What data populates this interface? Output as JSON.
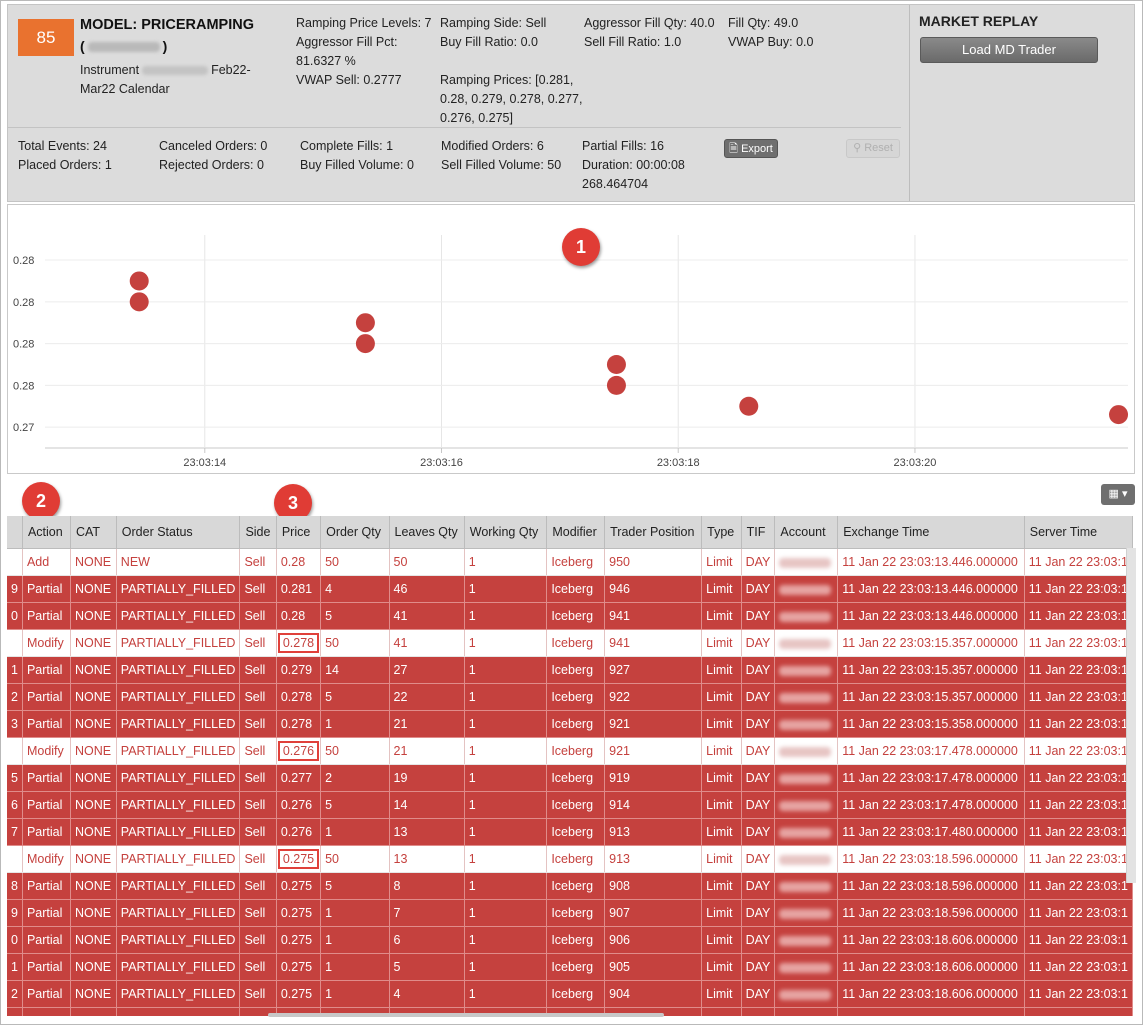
{
  "header": {
    "score": "85",
    "model_title": "MODEL: PRICERAMPING",
    "model_sub_open": "(",
    "model_sub_close": ")",
    "instrument_prefix": "Instrument",
    "instrument_suffix": "Feb22-Mar22 Calendar",
    "ramping_price_levels": "Ramping Price Levels: 7",
    "aggressor_fill_pct": "Aggressor Fill Pct: 81.6327 %",
    "vwap_sell": "VWAP Sell: 0.2777",
    "ramping_side": "Ramping Side: Sell",
    "buy_fill_ratio": "Buy Fill Ratio: 0.0",
    "ramping_prices": "Ramping Prices: [0.281, 0.28, 0.279, 0.278, 0.277, 0.276, 0.275]",
    "aggressor_fill_qty": "Aggressor Fill Qty: 40.0",
    "sell_fill_ratio": "Sell Fill Ratio: 1.0",
    "fill_qty": "Fill Qty: 49.0",
    "vwap_buy": "VWAP Buy: 0.0",
    "total_events": "Total Events: 24",
    "placed_orders": "Placed Orders: 1",
    "canceled_orders": "Canceled Orders: 0",
    "rejected_orders": "Rejected Orders: 0",
    "complete_fills": "Complete Fills: 1",
    "buy_filled_volume": "Buy Filled Volume: 0",
    "modified_orders": "Modified Orders: 6",
    "sell_filled_volume": "Sell Filled Volume: 50",
    "partial_fills": "Partial Fills: 16",
    "duration": "Duration: 00:00:08 268.464704",
    "export_label": "Export",
    "reset_label": "Reset",
    "market_replay_title": "MARKET REPLAY",
    "load_md_label": "Load MD Trader"
  },
  "callouts": [
    "1",
    "2",
    "3"
  ],
  "chart_data": {
    "type": "scatter",
    "title": "",
    "xlabel": "",
    "ylabel": "",
    "x_tick_labels": [
      "23:03:14",
      "23:03:16",
      "23:03:18",
      "23:03:20"
    ],
    "x_tick_seconds": [
      14,
      16,
      18,
      20
    ],
    "y_tick_labels": [
      "0.28",
      "0.28",
      "0.28",
      "0.28",
      "0.27"
    ],
    "y_tick_values": [
      0.28,
      0.279,
      0.278,
      0.277,
      0.276
    ],
    "xlim_seconds": [
      12.65,
      21.8
    ],
    "ylim": [
      0.2755,
      0.2806
    ],
    "grid": true,
    "point_color": "#c5413e",
    "points": [
      {
        "t": 13.446,
        "price": 0.2795
      },
      {
        "t": 13.446,
        "price": 0.279
      },
      {
        "t": 15.357,
        "price": 0.2785
      },
      {
        "t": 15.357,
        "price": 0.278
      },
      {
        "t": 17.478,
        "price": 0.2775
      },
      {
        "t": 17.478,
        "price": 0.277
      },
      {
        "t": 18.596,
        "price": 0.2765
      },
      {
        "t": 21.72,
        "price": 0.2763
      }
    ]
  },
  "table": {
    "grid_button_label": "▦ ▾",
    "columns": [
      "",
      "Action",
      "CAT",
      "Order Status",
      "Side",
      "Price",
      "Order Qty",
      "Leaves Qty",
      "Working Qty",
      "Modifier",
      "Trader Position",
      "Type",
      "TIF",
      "Account",
      "Exchange Time",
      "Server Time"
    ],
    "rows": [
      {
        "style": "white",
        "idx": "",
        "action": "Add",
        "cat": "NONE",
        "status": "NEW",
        "side": "Sell",
        "price": "0.28",
        "order_qty": "50",
        "leaves": "50",
        "working": "1",
        "modifier": "Iceberg",
        "position": "950",
        "type": "Limit",
        "tif": "DAY",
        "exchange_time": "11 Jan 22 23:03:13.446.000000",
        "server_time": "11 Jan 22 23:03:1",
        "highlight": false
      },
      {
        "style": "red",
        "idx": "9",
        "action": "Partial",
        "cat": "NONE",
        "status": "PARTIALLY_FILLED",
        "side": "Sell",
        "price": "0.281",
        "order_qty": "4",
        "leaves": "46",
        "working": "1",
        "modifier": "Iceberg",
        "position": "946",
        "type": "Limit",
        "tif": "DAY",
        "exchange_time": "11 Jan 22 23:03:13.446.000000",
        "server_time": "11 Jan 22 23:03:1",
        "highlight": false
      },
      {
        "style": "red",
        "idx": "0",
        "action": "Partial",
        "cat": "NONE",
        "status": "PARTIALLY_FILLED",
        "side": "Sell",
        "price": "0.28",
        "order_qty": "5",
        "leaves": "41",
        "working": "1",
        "modifier": "Iceberg",
        "position": "941",
        "type": "Limit",
        "tif": "DAY",
        "exchange_time": "11 Jan 22 23:03:13.446.000000",
        "server_time": "11 Jan 22 23:03:1",
        "highlight": false
      },
      {
        "style": "white",
        "idx": "",
        "action": "Modify",
        "cat": "NONE",
        "status": "PARTIALLY_FILLED",
        "side": "Sell",
        "price": "0.278",
        "order_qty": "50",
        "leaves": "41",
        "working": "1",
        "modifier": "Iceberg",
        "position": "941",
        "type": "Limit",
        "tif": "DAY",
        "exchange_time": "11 Jan 22 23:03:15.357.000000",
        "server_time": "11 Jan 22 23:03:1",
        "highlight": true
      },
      {
        "style": "red",
        "idx": "1",
        "action": "Partial",
        "cat": "NONE",
        "status": "PARTIALLY_FILLED",
        "side": "Sell",
        "price": "0.279",
        "order_qty": "14",
        "leaves": "27",
        "working": "1",
        "modifier": "Iceberg",
        "position": "927",
        "type": "Limit",
        "tif": "DAY",
        "exchange_time": "11 Jan 22 23:03:15.357.000000",
        "server_time": "11 Jan 22 23:03:1",
        "highlight": false
      },
      {
        "style": "red",
        "idx": "2",
        "action": "Partial",
        "cat": "NONE",
        "status": "PARTIALLY_FILLED",
        "side": "Sell",
        "price": "0.278",
        "order_qty": "5",
        "leaves": "22",
        "working": "1",
        "modifier": "Iceberg",
        "position": "922",
        "type": "Limit",
        "tif": "DAY",
        "exchange_time": "11 Jan 22 23:03:15.357.000000",
        "server_time": "11 Jan 22 23:03:1",
        "highlight": false
      },
      {
        "style": "red",
        "idx": "3",
        "action": "Partial",
        "cat": "NONE",
        "status": "PARTIALLY_FILLED",
        "side": "Sell",
        "price": "0.278",
        "order_qty": "1",
        "leaves": "21",
        "working": "1",
        "modifier": "Iceberg",
        "position": "921",
        "type": "Limit",
        "tif": "DAY",
        "exchange_time": "11 Jan 22 23:03:15.358.000000",
        "server_time": "11 Jan 22 23:03:1",
        "highlight": false
      },
      {
        "style": "white",
        "idx": "",
        "action": "Modify",
        "cat": "NONE",
        "status": "PARTIALLY_FILLED",
        "side": "Sell",
        "price": "0.276",
        "order_qty": "50",
        "leaves": "21",
        "working": "1",
        "modifier": "Iceberg",
        "position": "921",
        "type": "Limit",
        "tif": "DAY",
        "exchange_time": "11 Jan 22 23:03:17.478.000000",
        "server_time": "11 Jan 22 23:03:1",
        "highlight": true
      },
      {
        "style": "red",
        "idx": "5",
        "action": "Partial",
        "cat": "NONE",
        "status": "PARTIALLY_FILLED",
        "side": "Sell",
        "price": "0.277",
        "order_qty": "2",
        "leaves": "19",
        "working": "1",
        "modifier": "Iceberg",
        "position": "919",
        "type": "Limit",
        "tif": "DAY",
        "exchange_time": "11 Jan 22 23:03:17.478.000000",
        "server_time": "11 Jan 22 23:03:1",
        "highlight": false
      },
      {
        "style": "red",
        "idx": "6",
        "action": "Partial",
        "cat": "NONE",
        "status": "PARTIALLY_FILLED",
        "side": "Sell",
        "price": "0.276",
        "order_qty": "5",
        "leaves": "14",
        "working": "1",
        "modifier": "Iceberg",
        "position": "914",
        "type": "Limit",
        "tif": "DAY",
        "exchange_time": "11 Jan 22 23:03:17.478.000000",
        "server_time": "11 Jan 22 23:03:1",
        "highlight": false
      },
      {
        "style": "red",
        "idx": "7",
        "action": "Partial",
        "cat": "NONE",
        "status": "PARTIALLY_FILLED",
        "side": "Sell",
        "price": "0.276",
        "order_qty": "1",
        "leaves": "13",
        "working": "1",
        "modifier": "Iceberg",
        "position": "913",
        "type": "Limit",
        "tif": "DAY",
        "exchange_time": "11 Jan 22 23:03:17.480.000000",
        "server_time": "11 Jan 22 23:03:1",
        "highlight": false
      },
      {
        "style": "white",
        "idx": "",
        "action": "Modify",
        "cat": "NONE",
        "status": "PARTIALLY_FILLED",
        "side": "Sell",
        "price": "0.275",
        "order_qty": "50",
        "leaves": "13",
        "working": "1",
        "modifier": "Iceberg",
        "position": "913",
        "type": "Limit",
        "tif": "DAY",
        "exchange_time": "11 Jan 22 23:03:18.596.000000",
        "server_time": "11 Jan 22 23:03:1",
        "highlight": true
      },
      {
        "style": "red",
        "idx": "8",
        "action": "Partial",
        "cat": "NONE",
        "status": "PARTIALLY_FILLED",
        "side": "Sell",
        "price": "0.275",
        "order_qty": "5",
        "leaves": "8",
        "working": "1",
        "modifier": "Iceberg",
        "position": "908",
        "type": "Limit",
        "tif": "DAY",
        "exchange_time": "11 Jan 22 23:03:18.596.000000",
        "server_time": "11 Jan 22 23:03:1",
        "highlight": false
      },
      {
        "style": "red",
        "idx": "9",
        "action": "Partial",
        "cat": "NONE",
        "status": "PARTIALLY_FILLED",
        "side": "Sell",
        "price": "0.275",
        "order_qty": "1",
        "leaves": "7",
        "working": "1",
        "modifier": "Iceberg",
        "position": "907",
        "type": "Limit",
        "tif": "DAY",
        "exchange_time": "11 Jan 22 23:03:18.596.000000",
        "server_time": "11 Jan 22 23:03:1",
        "highlight": false
      },
      {
        "style": "red",
        "idx": "0",
        "action": "Partial",
        "cat": "NONE",
        "status": "PARTIALLY_FILLED",
        "side": "Sell",
        "price": "0.275",
        "order_qty": "1",
        "leaves": "6",
        "working": "1",
        "modifier": "Iceberg",
        "position": "906",
        "type": "Limit",
        "tif": "DAY",
        "exchange_time": "11 Jan 22 23:03:18.606.000000",
        "server_time": "11 Jan 22 23:03:1",
        "highlight": false
      },
      {
        "style": "red",
        "idx": "1",
        "action": "Partial",
        "cat": "NONE",
        "status": "PARTIALLY_FILLED",
        "side": "Sell",
        "price": "0.275",
        "order_qty": "1",
        "leaves": "5",
        "working": "1",
        "modifier": "Iceberg",
        "position": "905",
        "type": "Limit",
        "tif": "DAY",
        "exchange_time": "11 Jan 22 23:03:18.606.000000",
        "server_time": "11 Jan 22 23:03:1",
        "highlight": false
      },
      {
        "style": "red",
        "idx": "2",
        "action": "Partial",
        "cat": "NONE",
        "status": "PARTIALLY_FILLED",
        "side": "Sell",
        "price": "0.275",
        "order_qty": "1",
        "leaves": "4",
        "working": "1",
        "modifier": "Iceberg",
        "position": "904",
        "type": "Limit",
        "tif": "DAY",
        "exchange_time": "11 Jan 22 23:03:18.606.000000",
        "server_time": "11 Jan 22 23:03:1",
        "highlight": false
      },
      {
        "style": "red",
        "idx": "",
        "action": "",
        "cat": "",
        "status": "",
        "side": "",
        "price": "",
        "order_qty": "",
        "leaves": "",
        "working": "",
        "modifier": "",
        "position": "",
        "type": "",
        "tif": "",
        "exchange_time": "",
        "server_time": "",
        "highlight": false
      }
    ]
  }
}
